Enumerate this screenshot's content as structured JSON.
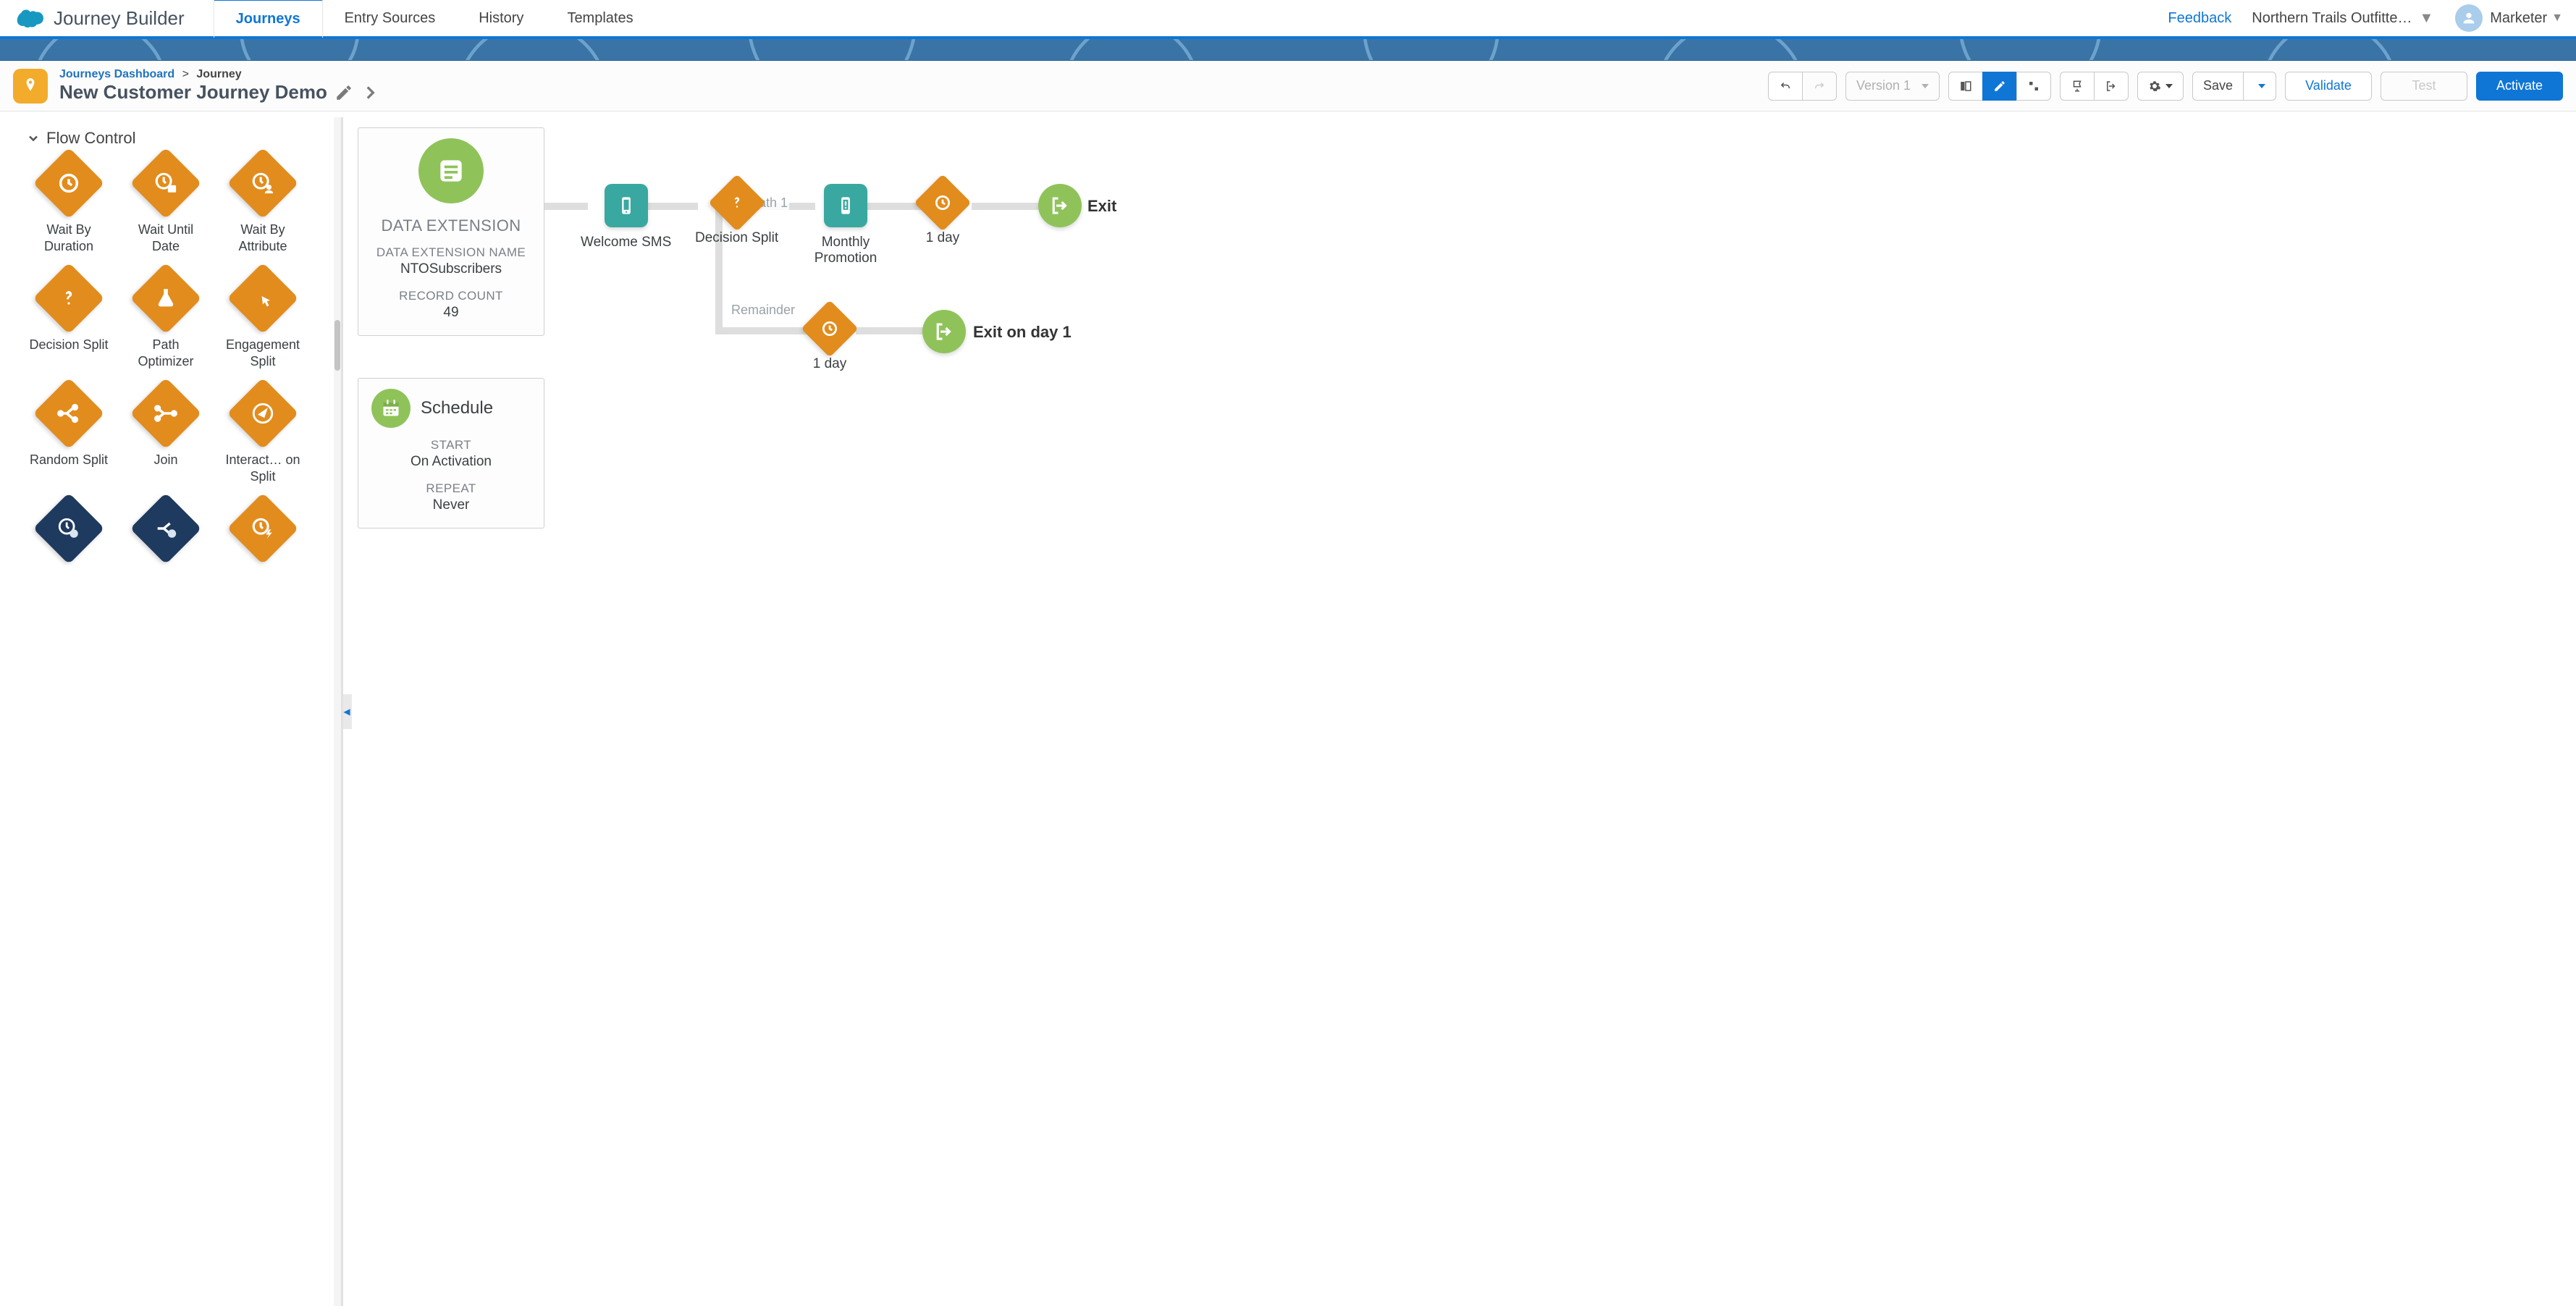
{
  "app": {
    "title": "Journey Builder"
  },
  "nav": {
    "tabs": [
      {
        "label": "Journeys",
        "active": true
      },
      {
        "label": "Entry Sources"
      },
      {
        "label": "History"
      },
      {
        "label": "Templates"
      }
    ],
    "feedback": "Feedback",
    "bu": "Northern Trails Outfitte…",
    "user": "Marketer"
  },
  "breadcrumb": {
    "root": "Journeys Dashboard",
    "separator": ">",
    "current": "Journey"
  },
  "page": {
    "title": "New Customer Journey Demo"
  },
  "toolbar": {
    "version": "Version 1",
    "save": "Save",
    "validate": "Validate",
    "test": "Test",
    "activate": "Activate"
  },
  "sidebar": {
    "section": "Flow Control",
    "tools": [
      {
        "label": "Wait By Duration",
        "icon": "clock"
      },
      {
        "label": "Wait Until Date",
        "icon": "clock-cal"
      },
      {
        "label": "Wait By Attribute",
        "icon": "clock-user"
      },
      {
        "label": "Decision Split",
        "icon": "question"
      },
      {
        "label": "Path Optimizer",
        "icon": "beaker"
      },
      {
        "label": "Engagement Split",
        "icon": "click"
      },
      {
        "label": "Random Split",
        "icon": "split"
      },
      {
        "label": "Join",
        "icon": "join"
      },
      {
        "label": "Interact… on Split",
        "icon": "compass"
      },
      {
        "label": "",
        "icon": "einstein",
        "navy": true
      },
      {
        "label": "",
        "icon": "einstein2",
        "navy": true
      },
      {
        "label": "",
        "icon": "clock-bolt"
      }
    ]
  },
  "de": {
    "heading": "DATA EXTENSION",
    "name_label": "DATA EXTENSION NAME",
    "name_value": "NTOSubscribers",
    "count_label": "RECORD COUNT",
    "count_value": "49"
  },
  "schedule": {
    "heading": "Schedule",
    "start_label": "START",
    "start_value": "On Activation",
    "repeat_label": "REPEAT",
    "repeat_value": "Never"
  },
  "canvas": {
    "path1_label": "Path 1",
    "remainder_label": "Remainder",
    "nodes": {
      "welcome": "Welcome SMS",
      "decision": "Decision Split",
      "monthly": "Monthly Promotion",
      "wait1": "1 day",
      "exit1": "Exit",
      "wait2": "1 day",
      "exit2": "Exit on day 1"
    }
  }
}
